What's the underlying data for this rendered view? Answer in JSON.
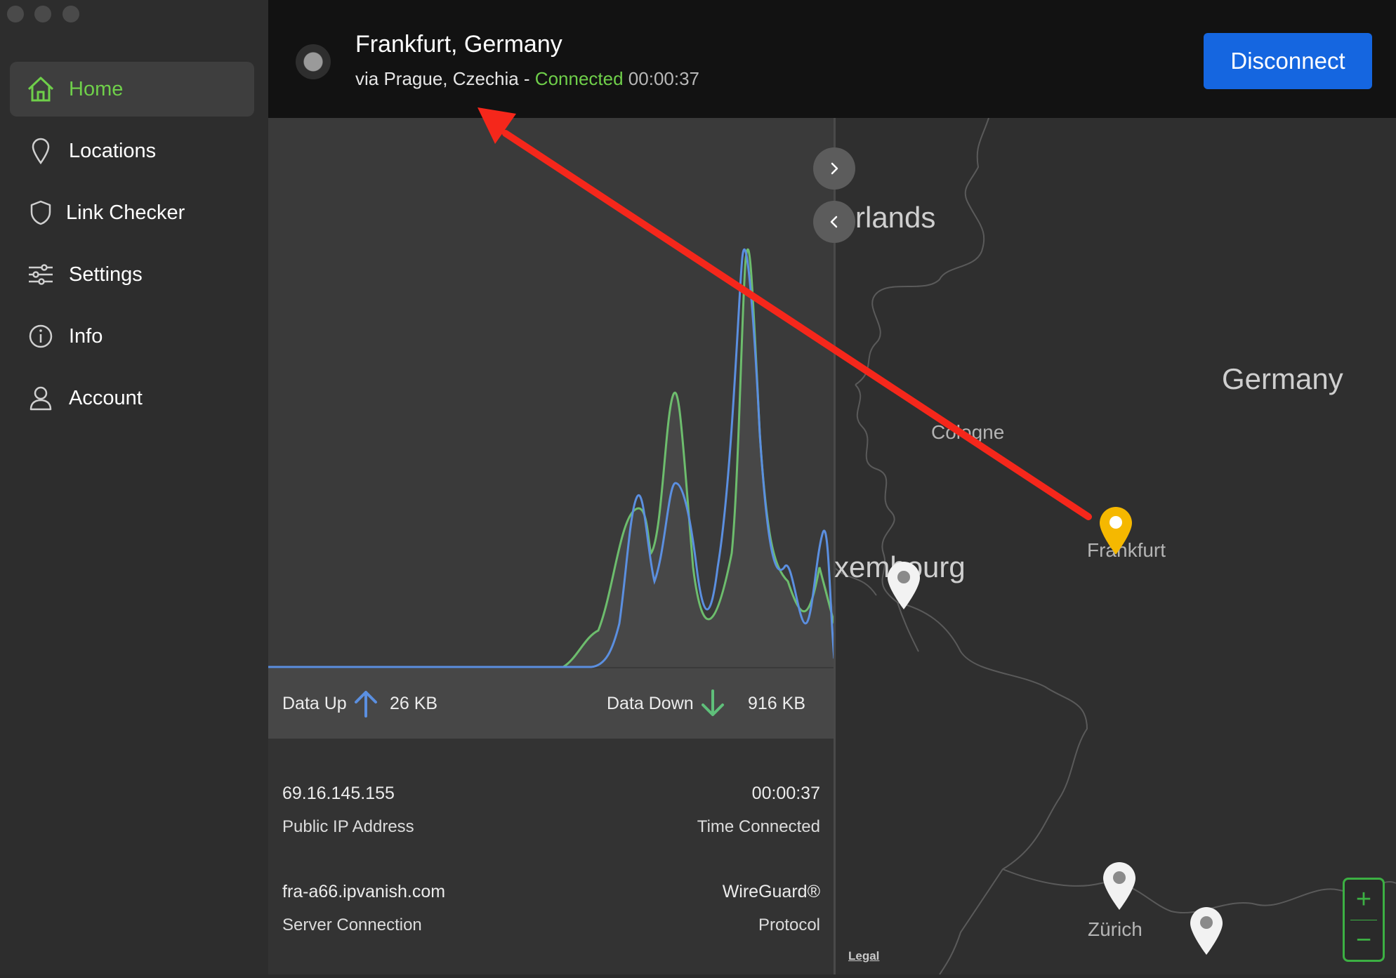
{
  "sidebar": {
    "items": [
      {
        "label": "Home",
        "icon": "home-icon",
        "active": true
      },
      {
        "label": "Locations",
        "icon": "location-pin-icon"
      },
      {
        "label": "Link Checker",
        "icon": "shield-icon"
      },
      {
        "label": "Settings",
        "icon": "sliders-icon"
      },
      {
        "label": "Info",
        "icon": "info-icon"
      },
      {
        "label": "Account",
        "icon": "user-icon"
      }
    ]
  },
  "header": {
    "title": "Frankfurt, Germany",
    "via": "via Prague, Czechia -",
    "status": "Connected",
    "timer": "00:00:37",
    "disconnect_label": "Disconnect"
  },
  "traffic": {
    "up_label": "Data Up",
    "up_value": "26 KB",
    "down_label": "Data Down",
    "down_value": "916 KB"
  },
  "stats": {
    "ip_value": "69.16.145.155",
    "ip_label": "Public IP Address",
    "time_value": "00:00:37",
    "time_label": "Time Connected",
    "server_value": "fra-a66.ipvanish.com",
    "server_label": "Server Connection",
    "protocol_value": "WireGuard®",
    "protocol_label": "Protocol"
  },
  "map": {
    "labels": {
      "netherlands": "rlands",
      "germany": "Germany",
      "cologne": "Cologne",
      "luxembourg": "xembourg",
      "frankfurt": "Frankfurt",
      "zurich": "Zürich"
    },
    "legal": "Legal",
    "zoom_in": "+",
    "zoom_out": "−"
  },
  "colors": {
    "accent_green": "#6fcf4a",
    "button_blue": "#1566e0",
    "pin_yellow": "#f5b800",
    "annotation_red": "#f5271b"
  }
}
